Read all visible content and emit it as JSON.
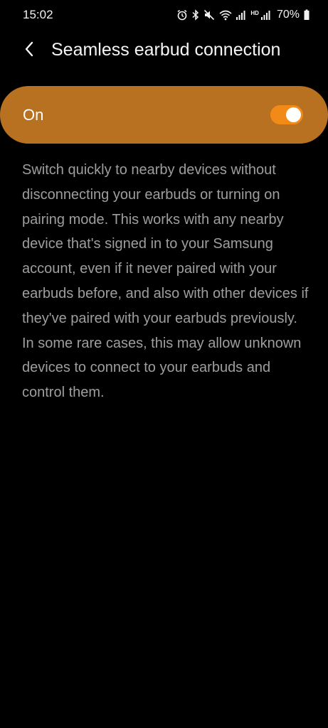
{
  "status_bar": {
    "time": "15:02",
    "icons": [
      "alarm-icon",
      "bluetooth-icon",
      "mute-icon",
      "wifi-icon",
      "signal-icon",
      "hd-label",
      "signal-icon",
      "battery-icon"
    ],
    "hd_label": "HD",
    "battery": "70%"
  },
  "header": {
    "back_icon": "chevron-left-icon",
    "title": "Seamless earbud connection"
  },
  "master_switch": {
    "label": "On",
    "checked": true,
    "bar_color": "#b87120",
    "toggle_color": "#f28a17"
  },
  "description": {
    "text": "Switch quickly to nearby devices without disconnecting your earbuds or turning on pairing mode. This works with any nearby device that's signed in to your Samsung account, even if it never paired with your earbuds before, and also with other devices if they've paired with your earbuds previously. In some rare cases, this may allow unknown devices to connect to your earbuds and control them."
  }
}
